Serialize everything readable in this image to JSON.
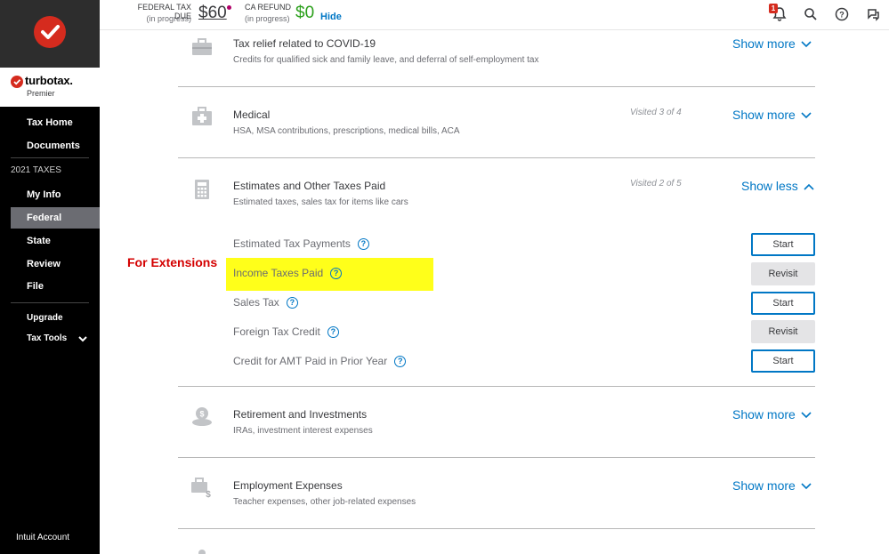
{
  "sidebar": {
    "brand_name": "turbotax.",
    "brand_edition": "Premier",
    "items_top": [
      {
        "label": "Tax Home"
      },
      {
        "label": "Documents"
      }
    ],
    "section_label": "2021 TAXES",
    "items_taxes": [
      {
        "label": "My Info"
      },
      {
        "label": "Federal",
        "active": true
      },
      {
        "label": "State"
      },
      {
        "label": "Review"
      },
      {
        "label": "File"
      }
    ],
    "upgrade_label": "Upgrade",
    "tax_tools_label": "Tax Tools",
    "account_label": "Intuit Account"
  },
  "header": {
    "federal_label": "FEDERAL TAX DUE",
    "federal_status": "(in progress)",
    "federal_amount": "$60",
    "ca_label": "CA REFUND",
    "ca_status": "(in progress)",
    "ca_amount": "$0",
    "hide_label": "Hide",
    "notification_count": "1",
    "icons": [
      "bell-icon",
      "search-icon",
      "help-icon",
      "chat-icon"
    ]
  },
  "sections": [
    {
      "title": "Tax relief related to COVID-19",
      "description": "Credits for qualified sick and family leave, and deferral of self-employment tax",
      "visited": "",
      "toggle": "Show more",
      "icon": "briefcase-icon"
    },
    {
      "title": "Medical",
      "description": "HSA, MSA contributions, prescriptions, medical bills, ACA",
      "visited": "Visited 3 of 4",
      "toggle": "Show more",
      "icon": "medical-kit-icon"
    },
    {
      "title": "Estimates and Other Taxes Paid",
      "description": "Estimated taxes, sales tax for items like cars",
      "visited": "Visited 2 of 5",
      "toggle": "Show less",
      "icon": "calculator-icon"
    },
    {
      "title": "Retirement and Investments",
      "description": "IRAs, investment interest expenses",
      "visited": "",
      "toggle": "Show more",
      "icon": "money-bag-icon"
    },
    {
      "title": "Employment Expenses",
      "description": "Teacher expenses, other job-related expenses",
      "visited": "",
      "toggle": "Show more",
      "icon": "briefcase-dollar-icon"
    }
  ],
  "sub_items": [
    {
      "label": "Estimated Tax Payments",
      "button": "Start"
    },
    {
      "label": "Income Taxes Paid",
      "button": "Revisit"
    },
    {
      "label": "Sales Tax",
      "button": "Start"
    },
    {
      "label": "Foreign Tax Credit",
      "button": "Revisit"
    },
    {
      "label": "Credit for AMT Paid in Prior Year",
      "button": "Start"
    }
  ],
  "annotation": {
    "text": "For Extensions",
    "text_color": "#d40000",
    "highlight_color": "#ffff1a"
  },
  "colors": {
    "accent": "#0077c5",
    "brand_red": "#d52b1e",
    "refund_green": "#2ca01c"
  }
}
